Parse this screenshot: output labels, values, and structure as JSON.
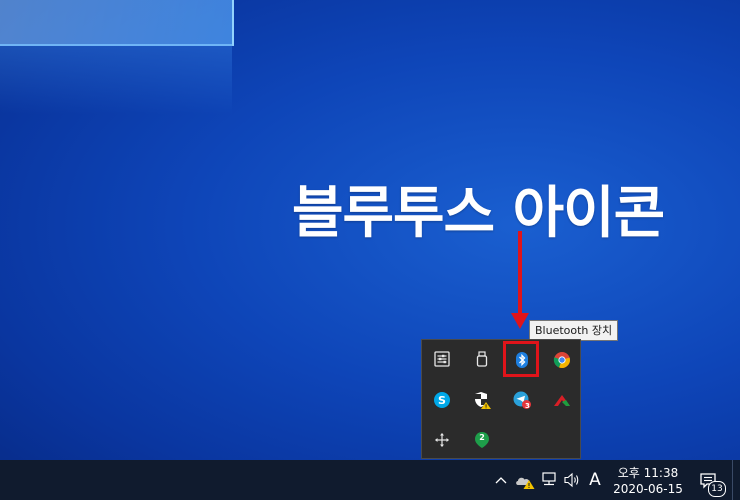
{
  "annotation": {
    "title": "블루투스 아이콘",
    "arrow_color": "#e0141a"
  },
  "tooltip": {
    "text": "Bluetooth 장치"
  },
  "tray_flyout": {
    "icons": [
      {
        "name": "settings-sliders-icon"
      },
      {
        "name": "usb-drive-icon"
      },
      {
        "name": "bluetooth-icon",
        "highlighted": true
      },
      {
        "name": "chrome-icon"
      },
      {
        "name": "skype-icon"
      },
      {
        "name": "security-warning-icon"
      },
      {
        "name": "telegram-icon",
        "badge": "3"
      },
      {
        "name": "app-red-green-icon"
      },
      {
        "name": "move-arrows-icon"
      },
      {
        "name": "green-badge-icon",
        "badge": "2"
      }
    ]
  },
  "taskbar": {
    "clock_time": "오후 11:38",
    "clock_date": "2020-06-15",
    "ime_indicator": "A",
    "notification_count": "13",
    "background": "#101b2e"
  }
}
